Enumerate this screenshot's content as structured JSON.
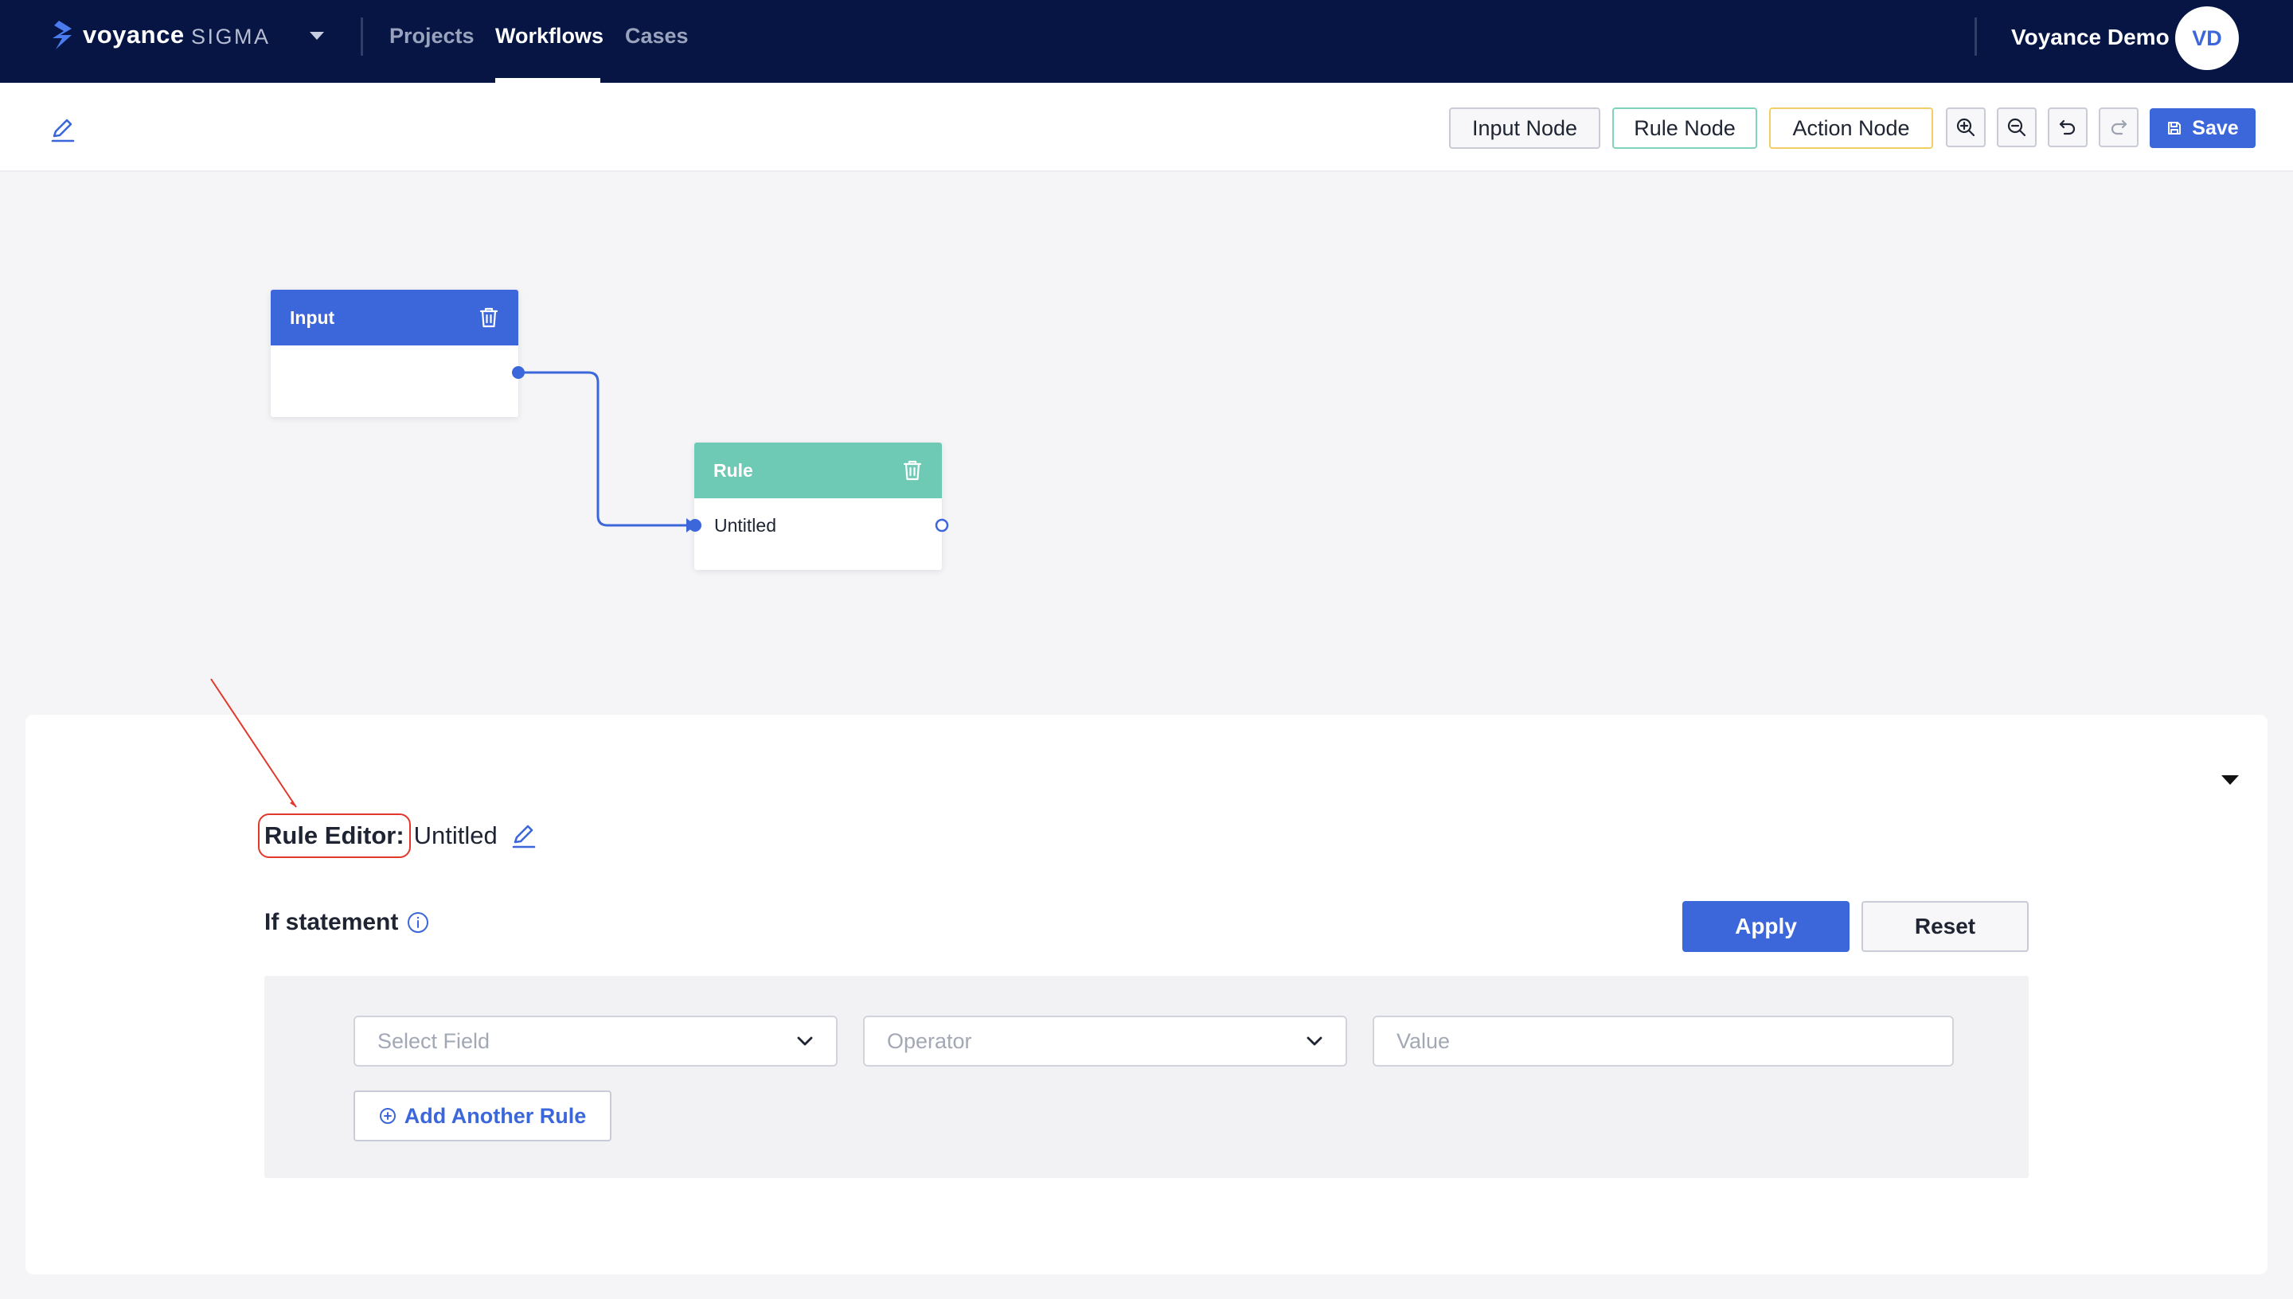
{
  "nav": {
    "brand": "voyance",
    "brand_sub": "SIGMA",
    "links": [
      "Projects",
      "Workflows",
      "Cases"
    ],
    "active_link": "Workflows",
    "user_name": "Voyance Demo",
    "user_initials": "VD"
  },
  "toolbar": {
    "input_node_label": "Input Node",
    "rule_node_label": "Rule Node",
    "action_node_label": "Action Node",
    "save_label": "Save",
    "icons": [
      "edit-icon",
      "zoom-in-icon",
      "zoom-out-icon",
      "undo-icon",
      "redo-icon",
      "save-icon"
    ]
  },
  "canvas": {
    "input_node": {
      "title": "Input"
    },
    "rule_node": {
      "title": "Rule",
      "body": "Untitled"
    }
  },
  "rule_editor": {
    "label": "Rule Editor:",
    "name": "Untitled",
    "if_label": "If statement",
    "apply_label": "Apply",
    "reset_label": "Reset",
    "field_placeholder": "Select Field",
    "operator_placeholder": "Operator",
    "value_placeholder": "Value",
    "add_rule_label": "Add Another Rule"
  },
  "colors": {
    "nav_bg": "#061543",
    "accent": "#3b67db",
    "rule_green": "#6ecab5",
    "action_yellow": "#f2cf66",
    "annotation_red": "#e2372b"
  }
}
